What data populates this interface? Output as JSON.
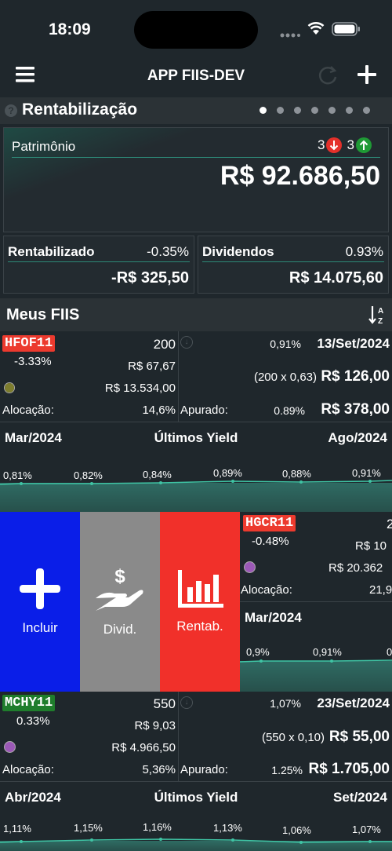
{
  "status": {
    "time": "18:09"
  },
  "nav": {
    "title": "APP FIIS-DEV"
  },
  "section": {
    "title": "Rentabilização",
    "page_dots": 7,
    "active_dot": 0
  },
  "patrimonio": {
    "label": "Patrimônio",
    "down_count": "3",
    "up_count": "3",
    "value": "R$ 92.686,50"
  },
  "rentabilizado": {
    "label": "Rentabilizado",
    "pct": "-0.35%",
    "value": "-R$ 325,50"
  },
  "dividendos": {
    "label": "Dividendos",
    "pct": "0.93%",
    "value": "R$ 14.075,60"
  },
  "meus": {
    "title": "Meus FIIS"
  },
  "fiis": [
    {
      "ticker": "HFOF11",
      "change": "-3.33%",
      "qty": "200",
      "price": "R$ 67,67",
      "total": "R$ 13.534,00",
      "dot_color": "#7d7d2e",
      "alloc_label": "Alocação:",
      "alloc": "14,6%",
      "yield_pct": "0,91%",
      "date": "13/Set/2024",
      "calc": "(200 x 0,63)",
      "div_value": "R$ 126,00",
      "apurado_label": "Apurado:",
      "apurado_pct": "0.89%",
      "apurado_value": "R$ 378,00",
      "chart": {
        "from": "Mar/2024",
        "title": "Últimos Yield",
        "to": "Ago/2024",
        "values": [
          "0,81%",
          "0,82%",
          "0,84%",
          "0,89%",
          "0,88%",
          "0,91%"
        ]
      }
    },
    {
      "ticker": "HGCR11",
      "change": "-0.48%",
      "qty": "2",
      "price": "R$ 10",
      "total": "R$ 20.362",
      "dot_color": "#9b59b6",
      "alloc_label": "Alocação:",
      "alloc": "21,9",
      "chart": {
        "from": "Mar/2024",
        "values": [
          "0,9%",
          "0,91%",
          "0"
        ]
      }
    },
    {
      "ticker": "MCHY11",
      "change": "0.33%",
      "qty": "550",
      "price": "R$ 9,03",
      "total": "R$ 4.966,50",
      "dot_color": "#9b59b6",
      "alloc_label": "Alocação:",
      "alloc": "5,36%",
      "yield_pct": "1,07%",
      "date": "23/Set/2024",
      "calc": "(550 x 0,10)",
      "div_value": "R$ 55,00",
      "apurado_label": "Apurado:",
      "apurado_pct": "1.25%",
      "apurado_value": "R$ 1.705,00",
      "chart": {
        "from": "Abr/2024",
        "title": "Últimos Yield",
        "to": "Set/2024",
        "values": [
          "1,11%",
          "1,15%",
          "1,16%",
          "1,13%",
          "1,06%",
          "1,07%"
        ]
      }
    }
  ],
  "swipe_actions": [
    {
      "label": "Incluir",
      "color": "#0a1ee8"
    },
    {
      "label": "Divid.",
      "color": "#8a8a8a"
    },
    {
      "label": "Rentab.",
      "color": "#f1302a"
    }
  ]
}
